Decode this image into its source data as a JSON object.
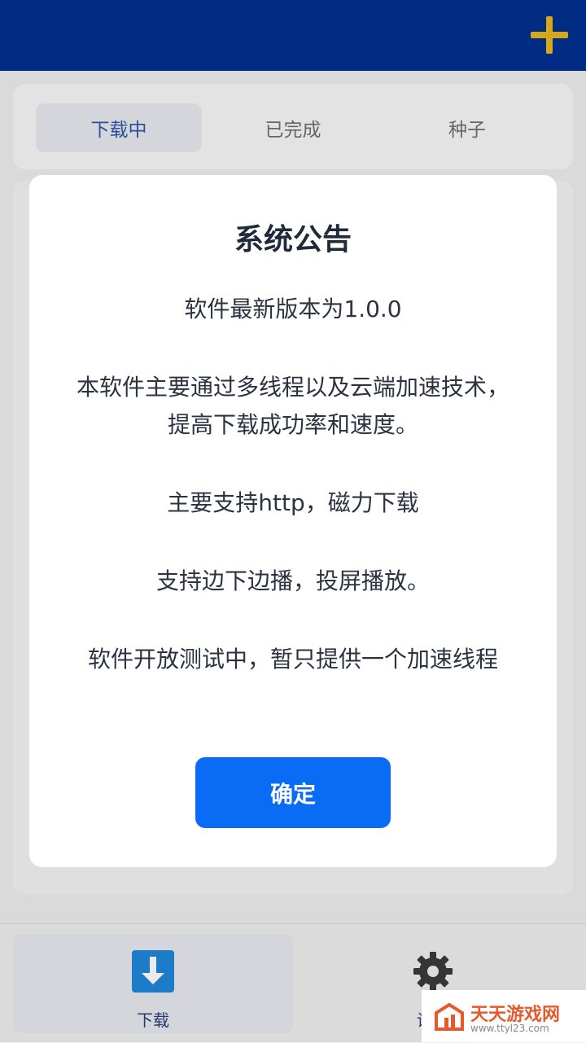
{
  "header": {
    "add_icon": "plus-icon",
    "add_color": "#e9b71c",
    "bg_color": "#01318f"
  },
  "tabs": [
    {
      "label": "下载中",
      "active": true
    },
    {
      "label": "已完成",
      "active": false
    },
    {
      "label": "种子",
      "active": false
    }
  ],
  "modal": {
    "title": "系统公告",
    "lines": [
      "软件最新版本为1.0.0",
      "本软件主要通过多线程以及云端加速技术，提高下载成功率和速度。",
      "主要支持http，磁力下载",
      "支持边下边播，投屏播放。",
      "软件开放测试中，暂只提供一个加速线程"
    ],
    "confirm_label": "确定",
    "confirm_color": "#0a6cf5"
  },
  "bottom_nav": [
    {
      "label": "下载",
      "icon": "download-icon",
      "active": true
    },
    {
      "label": "设置",
      "icon": "gear-icon",
      "active": false
    }
  ],
  "watermark": {
    "text": "天天游戏网",
    "url": "www.ttyl23.com"
  }
}
